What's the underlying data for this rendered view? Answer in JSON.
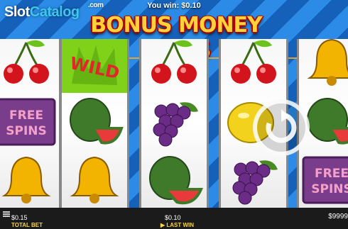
{
  "logo": {
    "part1": "Slot",
    "part2": "Catalog",
    "suffix": ".com"
  },
  "header": {
    "win_label": "You win:",
    "win_value": "$0.10"
  },
  "title": "BONUS MONEY SPINS",
  "reels": [
    [
      "cherries-symbol",
      "free-spins-symbol",
      "bell-symbol"
    ],
    [
      "wild-symbol",
      "watermelon-symbol",
      "bell-symbol"
    ],
    [
      "cherries-symbol",
      "grapes-symbol",
      "watermelon-symbol"
    ],
    [
      "cherries-symbol",
      "lemon-symbol",
      "grapes-symbol"
    ],
    [
      "bell-symbol",
      "watermelon-symbol",
      "free-spins-symbol"
    ]
  ],
  "symbols": {
    "wild_text": "WILD",
    "free_text_1": "FREE",
    "free_text_2": "SPINS"
  },
  "footer": {
    "total_bet_value": "$0.15",
    "total_bet_label": "TOTAL BET",
    "last_win_value": "$0.10",
    "last_win_label": "LAST WIN",
    "ticker_text": "$9999"
  },
  "colors": {
    "title": "#ffd23a",
    "title_outline": "#b30000",
    "wild_bg": "#7fd11a",
    "payline": "#f5a623",
    "label": "#f5d34a"
  }
}
